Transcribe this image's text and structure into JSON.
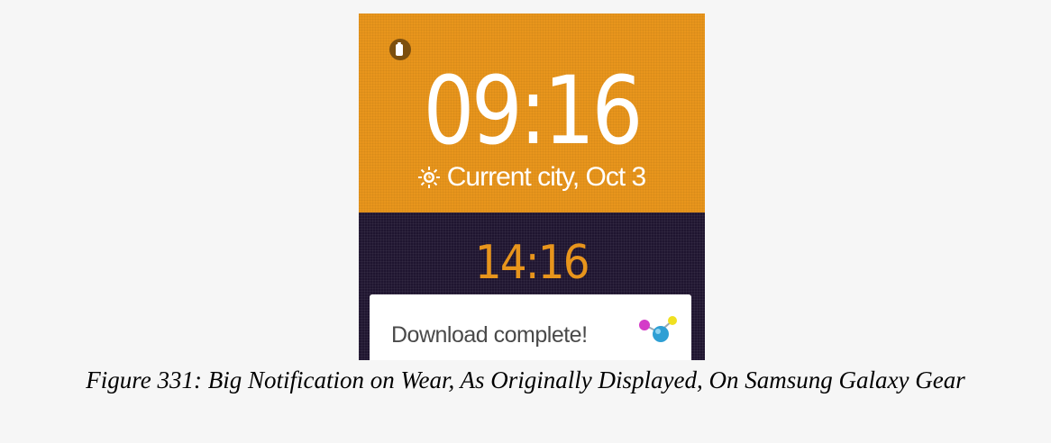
{
  "watch": {
    "main_time": "09:16",
    "location_date": "Current city, Oct 3",
    "weather_icon": "sun-icon",
    "second_time": "14:16",
    "battery_icon": "battery-icon"
  },
  "notification": {
    "text": "Download complete!",
    "icon": "molecule-app-icon"
  },
  "caption": "Figure 331: Big Notification on Wear, As Originally Displayed, On Samsung Galaxy Gear",
  "colors": {
    "accent_orange": "#e8951c",
    "dark_panel": "#1f1530",
    "page_background": "#f6f6f6"
  }
}
